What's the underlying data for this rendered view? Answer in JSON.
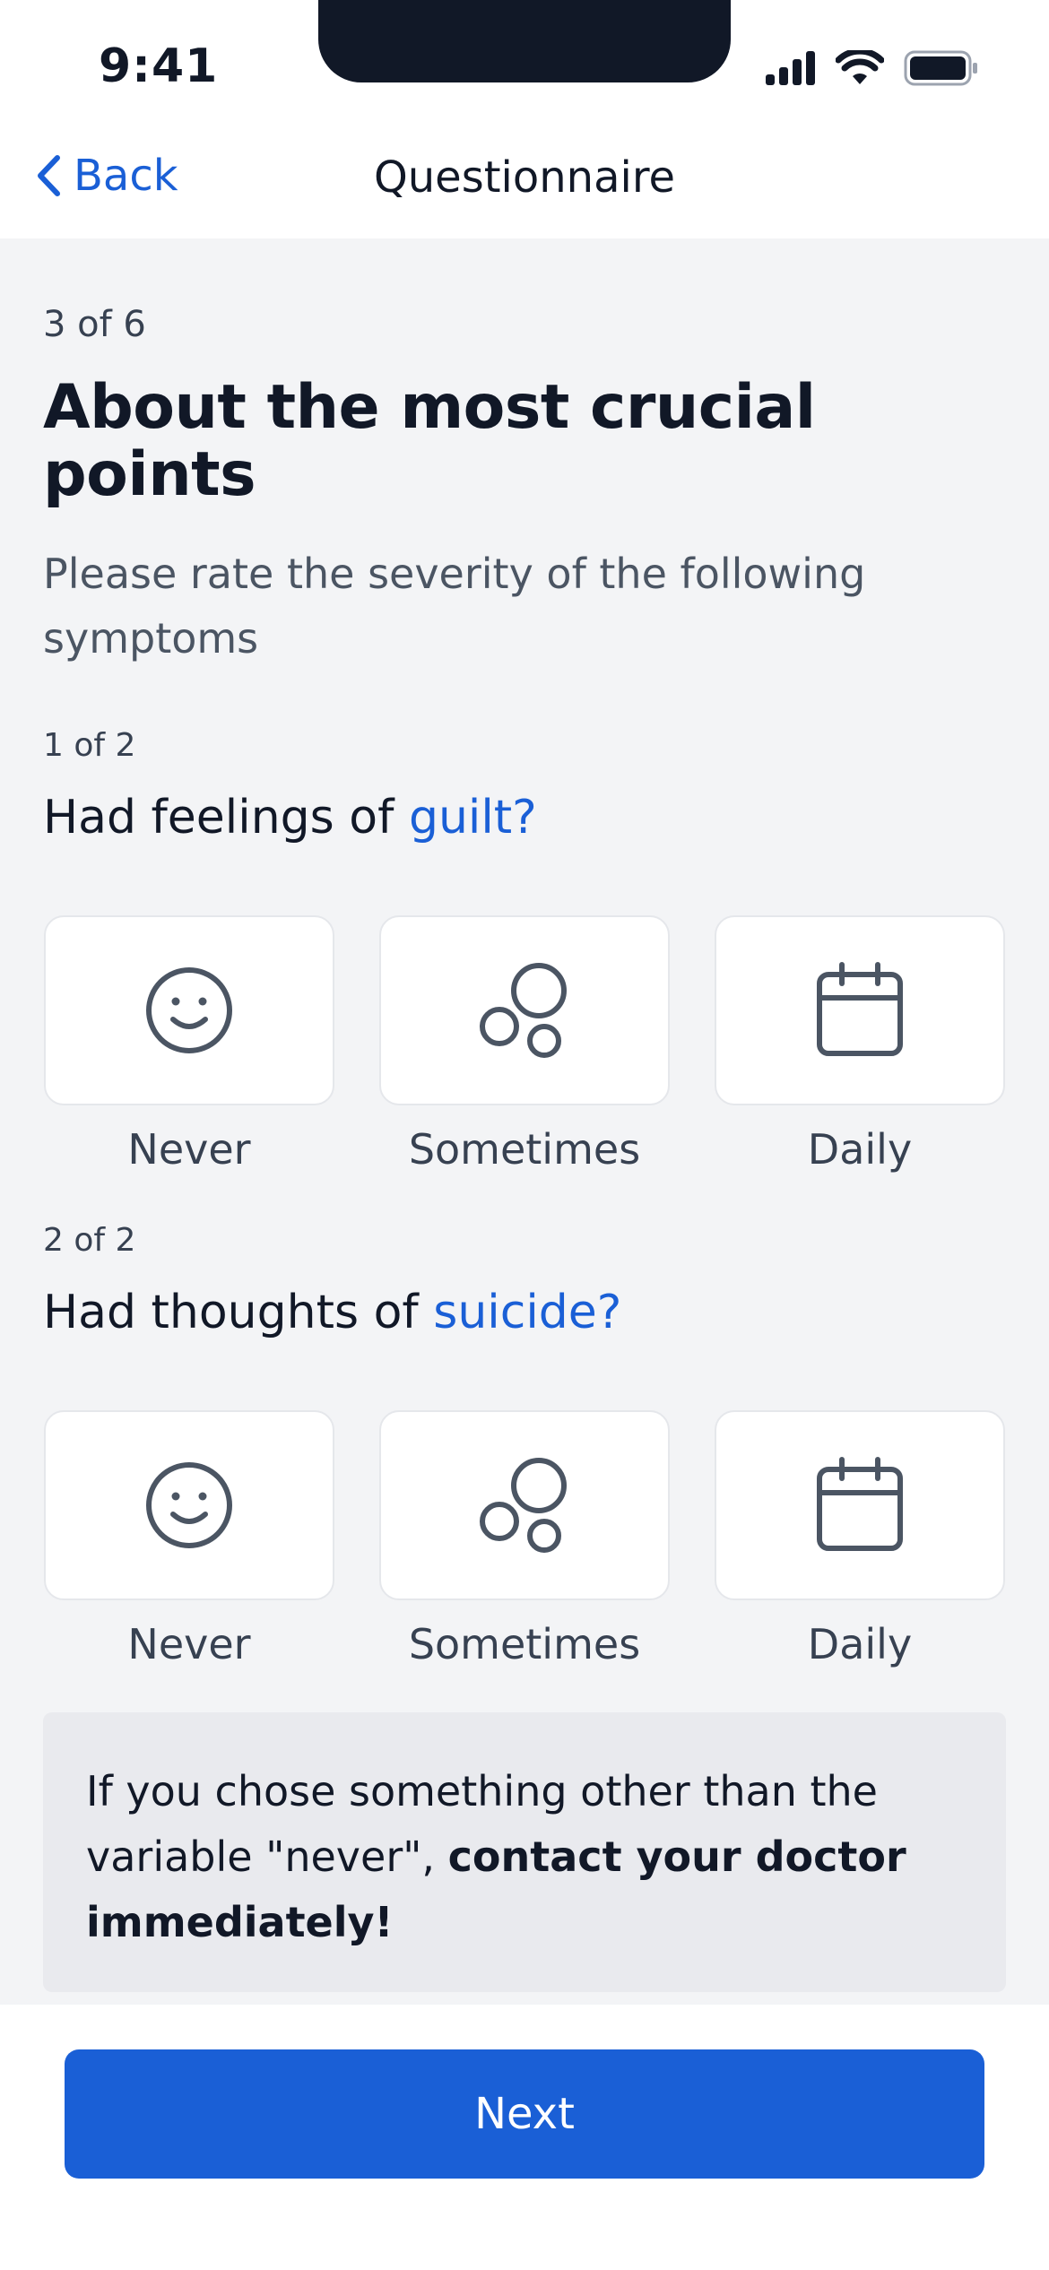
{
  "status_bar": {
    "time": "9:41",
    "icons": [
      "cellular-signal-icon",
      "wifi-icon",
      "battery-icon"
    ]
  },
  "nav": {
    "back_label": "Back",
    "title": "Questionnaire"
  },
  "progress": {
    "counter": "3 of 6",
    "current_step": 3,
    "total_steps": 6
  },
  "page": {
    "title": "About the most crucial points",
    "subtitle": "Please rate the severity of the following symptoms"
  },
  "questions": [
    {
      "counter": "1 of 2",
      "prefix": "Had feelings of ",
      "accent": "guilt?",
      "options": [
        {
          "label": "Never",
          "icon": "smiley-face-icon"
        },
        {
          "label": "Sometimes",
          "icon": "bubbles-icon"
        },
        {
          "label": "Daily",
          "icon": "calendar-icon"
        }
      ]
    },
    {
      "counter": "2 of 2",
      "prefix": "Had thoughts of ",
      "accent": "suicide?",
      "options": [
        {
          "label": "Never",
          "icon": "smiley-face-icon"
        },
        {
          "label": "Sometimes",
          "icon": "bubbles-icon"
        },
        {
          "label": "Daily",
          "icon": "calendar-icon"
        }
      ]
    }
  ],
  "warning": {
    "text_plain": "If you chose something other than the variable \"never\", ",
    "text_bold": "contact your doctor immediately!"
  },
  "footer": {
    "next_label": "Next"
  },
  "colors": {
    "accent": "#1a5fd6",
    "background": "#f3f4f6",
    "card": "#ffffff",
    "icon_stroke": "#4b5563",
    "warning_bg": "#e9eaee"
  }
}
